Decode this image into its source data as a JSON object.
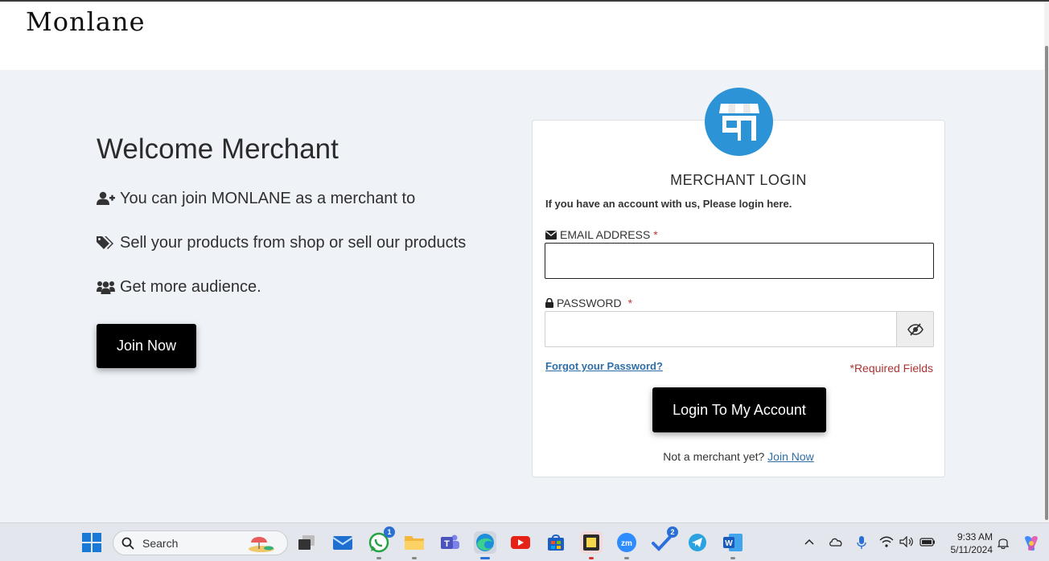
{
  "header": {
    "logo": "Monlane"
  },
  "welcome": {
    "title": "Welcome Merchant",
    "perks": [
      {
        "icon": "user-plus-icon",
        "text": "You can join MONLANE as a merchant to"
      },
      {
        "icon": "tags-icon",
        "text": "Sell your products from shop or sell our products"
      },
      {
        "icon": "users-icon",
        "text": "Get more audience."
      }
    ],
    "join_button": "Join Now"
  },
  "login": {
    "title": "MERCHANT LOGIN",
    "subtitle": "If you have an account with us, Please login here.",
    "email_label": "EMAIL ADDRESS",
    "password_label": "PASSWORD",
    "required_mark": "*",
    "email_value": "",
    "password_value": "",
    "forgot_link": "Forgot your Password?",
    "required_note": "*Required Fields",
    "submit_button": "Login To My Account",
    "not_merchant_text": "Not a merchant yet?",
    "join_link": "Join Now",
    "badge_color": "#2c93d6"
  },
  "taskbar": {
    "search_placeholder": "Search",
    "apps": [
      {
        "name": "task-view",
        "icon": "task-view-icon"
      },
      {
        "name": "mail",
        "icon": "mail-icon"
      },
      {
        "name": "whatsapp",
        "icon": "whatsapp-icon",
        "badge": "1"
      },
      {
        "name": "file-explorer",
        "icon": "folder-icon"
      },
      {
        "name": "teams",
        "icon": "teams-icon"
      },
      {
        "name": "edge",
        "icon": "edge-icon"
      },
      {
        "name": "youtube",
        "icon": "youtube-icon"
      },
      {
        "name": "store",
        "icon": "store-icon"
      },
      {
        "name": "sticky-notes",
        "icon": "sticky-notes-icon"
      },
      {
        "name": "zoom",
        "icon": "zoom-icon",
        "label": "zm"
      },
      {
        "name": "todo",
        "icon": "todo-icon",
        "badge": "2"
      },
      {
        "name": "telegram",
        "icon": "telegram-icon"
      },
      {
        "name": "word",
        "icon": "word-icon",
        "label": "W"
      }
    ],
    "time": "9:33 AM",
    "date": "5/11/2024"
  }
}
